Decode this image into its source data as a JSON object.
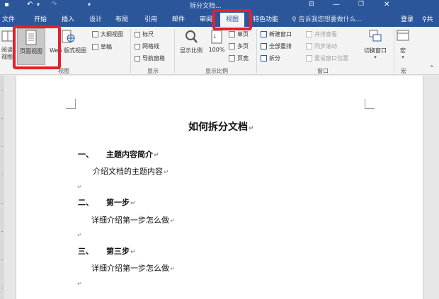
{
  "titlebar": {
    "title": "拆分文档...",
    "icons": [
      "save-icon",
      "undo-icon",
      "redo-icon",
      "customize-icon"
    ],
    "undo_glyph": "↶",
    "redo_glyph": "↷",
    "save_glyph": "▪",
    "more_glyph": "▾"
  },
  "tabs": [
    {
      "label": "文件"
    },
    {
      "label": "开始"
    },
    {
      "label": "插入"
    },
    {
      "label": "设计"
    },
    {
      "label": "布局"
    },
    {
      "label": "引用"
    },
    {
      "label": "邮件"
    },
    {
      "label": "审阅"
    },
    {
      "label": "视图",
      "active": true
    },
    {
      "label": "特色功能"
    }
  ],
  "tell_me": "告诉我您想要做什么...",
  "login": "登录",
  "share": "共",
  "ribbon": {
    "views": {
      "read_mode": "阅读视图",
      "print_layout": "页面视图",
      "web_layout": "Web 版式视图",
      "outline": "大纲视图",
      "draft": "草稿",
      "group_label": "视图"
    },
    "show": {
      "ruler": "标尺",
      "gridlines": "网格线",
      "nav_pane": "导航窗格",
      "group_label": "显示"
    },
    "zoom": {
      "zoom": "显示比例",
      "hundred": "100%",
      "one_page": "单页",
      "multi_page": "多页",
      "page_width": "页宽",
      "group_label": "显示比例"
    },
    "window": {
      "new_window": "新建窗口",
      "arrange_all": "全部重排",
      "split": "拆分",
      "side_by_side": "并排查看",
      "sync_scroll": "同步滚动",
      "reset_position": "重设窗口位置",
      "switch_windows": "切换窗口",
      "group_label": "窗口"
    },
    "macros": {
      "label": "宏",
      "group_label": "宏"
    }
  },
  "document": {
    "title": "如何拆分文档",
    "sections": [
      {
        "num": "一、",
        "heading": "主题内容简介",
        "body": "介绍文档的主题内容"
      },
      {
        "num": "二、",
        "heading": "第一步",
        "body": "详细介绍第一步怎么做"
      },
      {
        "num": "三、",
        "heading": "第三步",
        "body": "详细介绍第一步怎么做"
      }
    ],
    "para_mark": "↵"
  },
  "colors": {
    "brand": "#2b579a",
    "highlight": "#e5202a",
    "ribbon_bg": "#f3f3f3"
  }
}
